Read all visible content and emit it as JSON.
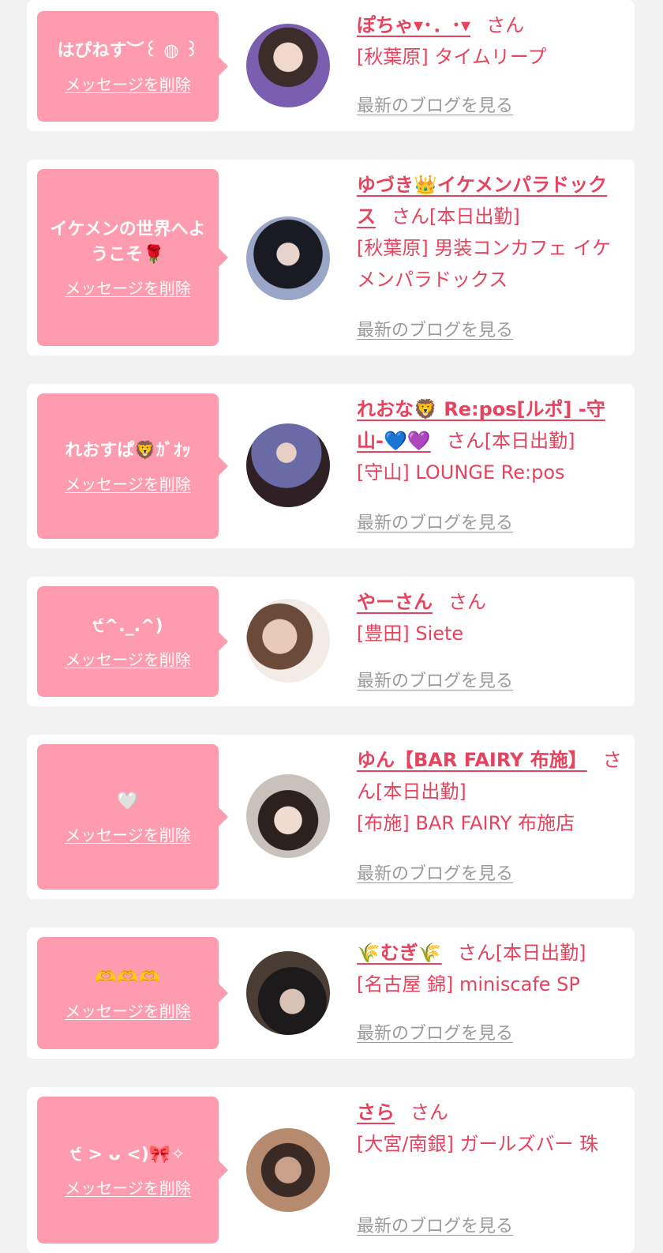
{
  "cards": [
    {
      "message": "はぴねす︶꒰ ◍ ꒱",
      "delete_label": "メッセージを削除",
      "name": "ぽちゃ▾･．･▾",
      "san": "さん",
      "attendance": "",
      "shop": "[秋葉原] タイムリープ",
      "blog_label": "最新のブログを見る",
      "avatar_colors": [
        "#3a2d2a",
        "#7a5fb0"
      ]
    },
    {
      "message": "イケメンの世界へようこそ🌹",
      "delete_label": "メッセージを削除",
      "name": "ゆづき👑イケメンパラドックス",
      "san": "さん",
      "attendance": "[本日出勤]",
      "shop": "[秋葉原] 男装コンカフェ イケメンパラドックス",
      "blog_label": "最新のブログを見る",
      "avatar_colors": [
        "#9aa6c7",
        "#1a1a22"
      ]
    },
    {
      "message": "れおすぱ🦁ｶﾞｵｯ",
      "delete_label": "メッセージを削除",
      "name": "れおな🦁 Re:pos[ルポ] -守山-💙💜",
      "san": "さん",
      "attendance": "[本日出勤]",
      "shop": "[守山] LOUNGE Re:pos",
      "blog_label": "最新のブログを見る",
      "avatar_colors": [
        "#2e2024",
        "#6a6aa6"
      ]
    },
    {
      "message": "੯^._.^)",
      "delete_label": "メッセージを削除",
      "name": "やーさん",
      "san": "さん",
      "attendance": "",
      "shop": "[豊田] Siete",
      "blog_label": "最新のブログを見る",
      "avatar_colors": [
        "#f2ebe6",
        "#6b4a3a"
      ]
    },
    {
      "message": "🤍",
      "delete_label": "メッセージを削除",
      "name": "ゆん【BAR FAIRY 布施】",
      "san": "さん",
      "attendance": "[本日出勤]",
      "shop": "[布施] BAR FAIRY 布施店",
      "blog_label": "最新のブログを見る",
      "avatar_colors": [
        "#c9c2bc",
        "#2b2220"
      ]
    },
    {
      "message": "🫶🫶🫶",
      "delete_label": "メッセージを削除",
      "name": "🌾むぎ🌾",
      "san": "さん",
      "attendance": "[本日出勤]",
      "shop": "[名古屋 錦] miniscafe SP",
      "blog_label": "最新のブログを見る",
      "avatar_colors": [
        "#4a3d36",
        "#1d1a1c"
      ]
    },
    {
      "message": "੯ > ᴗ <)🎀✧",
      "delete_label": "メッセージを削除",
      "name": "さら",
      "san": "さん",
      "attendance": "",
      "shop": "[大宮/南銀] ガールズバー 珠",
      "blog_label": "最新のブログを見る",
      "avatar_colors": [
        "#b58a6e",
        "#3a2a26"
      ]
    }
  ]
}
